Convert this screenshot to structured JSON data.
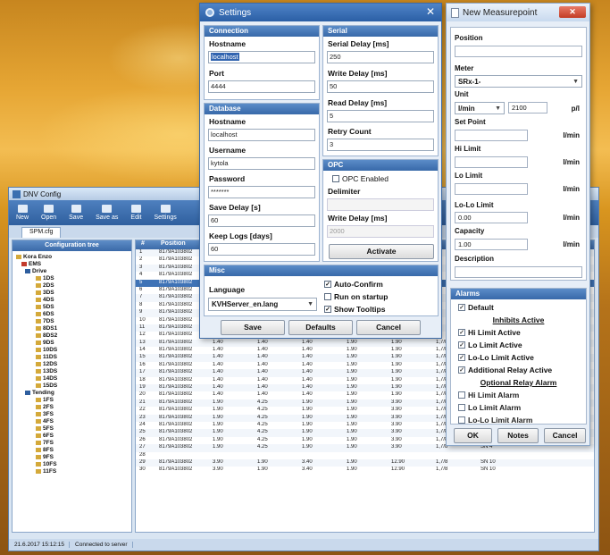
{
  "main": {
    "title": "DNV Config",
    "toolbar": [
      "New",
      "Open",
      "Save",
      "Save as",
      "Edit",
      "Settings"
    ],
    "tab": "SPM.cfg",
    "tree_header": "Configuration tree",
    "tree_nodes": [
      "Kora Enzo",
      "EMS",
      "Drive",
      "1DS",
      "2DS",
      "3DS",
      "4DS",
      "5DS",
      "6DS",
      "7DS",
      "8DS1",
      "8DS2",
      "9DS",
      "10DS",
      "11DS",
      "12DS",
      "13DS",
      "14DS",
      "15DS",
      "Tending",
      "1FS",
      "2FS",
      "3FS",
      "4FS",
      "5FS",
      "6FS",
      "7FS",
      "8FS",
      "9FS",
      "10FS",
      "11FS"
    ],
    "grid_headers": [
      "#",
      "Position"
    ],
    "grid_rows": [
      [
        "1",
        "8179A103802",
        "",
        "",
        "",
        "",
        "",
        "",
        ""
      ],
      [
        "2",
        "8179A103802",
        "",
        "",
        "",
        "",
        "",
        "",
        ""
      ],
      [
        "3",
        "8179A103802",
        "",
        "",
        "",
        "",
        "",
        "",
        ""
      ],
      [
        "4",
        "8179A103802",
        "",
        "",
        "",
        "",
        "",
        "",
        ""
      ],
      [
        "5",
        "8179A103802",
        "",
        "",
        "",
        "",
        "",
        "",
        ""
      ],
      [
        "6",
        "8179A103802",
        "",
        "",
        "",
        "",
        "",
        "",
        ""
      ],
      [
        "7",
        "8179A103802",
        "",
        "",
        "",
        "",
        "",
        "",
        ""
      ],
      [
        "8",
        "8179A103802",
        "",
        "",
        "",
        "",
        "",
        "",
        ""
      ],
      [
        "9",
        "8179A103802",
        "",
        "",
        "",
        "",
        "",
        "",
        ""
      ],
      [
        "10",
        "8179A103802",
        "",
        "",
        "",
        "",
        "",
        "",
        ""
      ],
      [
        "11",
        "8179A103802",
        "",
        "",
        "",
        "",
        "",
        "",
        ""
      ],
      [
        "12",
        "8179A103802",
        "",
        "",
        "",
        "",
        "",
        "",
        ""
      ],
      [
        "13",
        "8179A103802",
        "1.40",
        "1.40",
        "1.40",
        "1.90",
        "1.90",
        "1,7/8",
        ""
      ],
      [
        "14",
        "8179A103802",
        "1.40",
        "1.40",
        "1.40",
        "1.90",
        "1.90",
        "1,7/8",
        ""
      ],
      [
        "15",
        "8179A103802",
        "1.40",
        "1.40",
        "1.40",
        "1.90",
        "1.90",
        "1,7/8",
        ""
      ],
      [
        "16",
        "8179A103802",
        "1.40",
        "1.40",
        "1.40",
        "1.90",
        "1.90",
        "1,7/8",
        ""
      ],
      [
        "17",
        "8179A103802",
        "1.40",
        "1.40",
        "1.40",
        "1.90",
        "1.90",
        "1,7/8",
        ""
      ],
      [
        "18",
        "8179A103802",
        "1.40",
        "1.40",
        "1.40",
        "1.90",
        "1.90",
        "1,7/8",
        ""
      ],
      [
        "19",
        "8179A103802",
        "1.40",
        "1.40",
        "1.40",
        "1.90",
        "1.90",
        "1,7/8",
        ""
      ],
      [
        "20",
        "8179A103802",
        "1.40",
        "1.40",
        "1.40",
        "1.90",
        "1.90",
        "1,7/8",
        ""
      ],
      [
        "21",
        "8179A103802",
        "1.90",
        "4.25",
        "1.90",
        "1.90",
        "3.90",
        "1,7/8",
        "SN 4"
      ],
      [
        "22",
        "8179A103802",
        "1.90",
        "4.25",
        "1.90",
        "1.90",
        "3.90",
        "1,7/8",
        "SN 4"
      ],
      [
        "23",
        "8179A103802",
        "1.90",
        "4.25",
        "1.90",
        "1.90",
        "3.90",
        "1,7/8",
        "SN 4"
      ],
      [
        "24",
        "8179A103802",
        "1.90",
        "4.25",
        "1.90",
        "1.90",
        "3.90",
        "1,7/8",
        "SN 4"
      ],
      [
        "25",
        "8179A103802",
        "1.90",
        "4.25",
        "1.90",
        "1.90",
        "3.90",
        "1,7/8",
        "SN 4"
      ],
      [
        "26",
        "8179A103802",
        "1.90",
        "4.25",
        "1.90",
        "1.90",
        "3.90",
        "1,7/8",
        "SN 4"
      ],
      [
        "27",
        "8179A103802",
        "1.90",
        "4.25",
        "1.90",
        "1.90",
        "3.90",
        "1,7/8",
        "SN 4"
      ],
      [
        "28",
        "",
        "",
        "",
        "",
        "",
        "",
        "",
        ""
      ],
      [
        "29",
        "8179A103802",
        "3.90",
        "1.90",
        "3.40",
        "1.90",
        "12.90",
        "1,7/8",
        "SN 10"
      ],
      [
        "30",
        "8179A103802",
        "3.90",
        "1.90",
        "3.40",
        "1.90",
        "12.90",
        "1,7/8",
        "SN 10"
      ]
    ],
    "status": [
      "21.6.2017 15:12:15",
      "Connected to server"
    ]
  },
  "settings": {
    "title": "Settings",
    "connection": {
      "header": "Connection",
      "hostname_label": "Hostname",
      "hostname": "localhost",
      "port_label": "Port",
      "port": "4444"
    },
    "database": {
      "header": "Database",
      "hostname_label": "Hostname",
      "hostname": "localhost",
      "username_label": "Username",
      "username": "kytola",
      "password_label": "Password",
      "password": "*******",
      "save_delay_label": "Save Delay [s]",
      "save_delay": "60",
      "keep_logs_label": "Keep Logs [days]",
      "keep_logs": "60"
    },
    "serial": {
      "header": "Serial",
      "serial_delay_label": "Serial Delay [ms]",
      "serial_delay": "250",
      "write_delay_label": "Write Delay [ms]",
      "write_delay": "50",
      "read_delay_label": "Read Delay [ms]",
      "read_delay": "5",
      "retry_count_label": "Retry Count",
      "retry_count": "3"
    },
    "opc": {
      "header": "OPC",
      "enabled_label": "OPC Enabled",
      "delimiter_label": "Delimiter",
      "write_delay_label": "Write Delay [ms]",
      "write_delay": "2000",
      "activate_label": "Activate"
    },
    "misc": {
      "header": "Misc",
      "language_label": "Language",
      "language_value": "KVHServer_en.lang",
      "auto_confirm": "Auto-Confirm",
      "run_on_startup": "Run on startup",
      "show_tooltips": "Show Tooltips"
    },
    "buttons": {
      "save": "Save",
      "defaults": "Defaults",
      "cancel": "Cancel"
    }
  },
  "measure": {
    "title": "New Measurepoint",
    "position_label": "Position",
    "meter_label": "Meter",
    "meter_value": "SRx-1-",
    "unit_label": "Unit",
    "unit_value": "l/min",
    "unit_amount": "2100",
    "unit_suffix": "p/l",
    "set_point_label": "Set Point",
    "set_point_unit": "l/min",
    "hi_limit_label": "Hi Limit",
    "hi_limit_unit": "l/min",
    "lo_limit_label": "Lo Limit",
    "lo_limit_unit": "l/min",
    "lolo_limit_label": "Lo-Lo Limit",
    "lolo_limit_value": "0.00",
    "lolo_limit_unit": "l/min",
    "capacity_label": "Capacity",
    "capacity_value": "1.00",
    "capacity_unit": "l/min",
    "description_label": "Description",
    "alarms": {
      "header": "Alarms",
      "default_label": "Default",
      "inhibits_header": "Inhibits Active",
      "hi_limit_active": "Hi Limit Active",
      "lo_limit_active": "Lo Limit Active",
      "lolo_limit_active": "Lo-Lo Limit Active",
      "additional_relay_active": "Additional Relay Active",
      "optional_header": "Optional Relay Alarm",
      "hi_limit_alarm": "Hi Limit Alarm",
      "lo_limit_alarm": "Lo Limit Alarm",
      "lolo_limit_alarm": "Lo-Lo Limit Alarm"
    },
    "buttons": {
      "ok": "OK",
      "notes": "Notes",
      "cancel": "Cancel"
    }
  },
  "colors": {
    "accent": "#3b6aa8",
    "desktop": "#e6a634"
  },
  "icons": [
    "gear-icon",
    "close-icon",
    "checkbox-checked-icon",
    "dropdown-arrow-icon",
    "measurepoint-icon"
  ]
}
